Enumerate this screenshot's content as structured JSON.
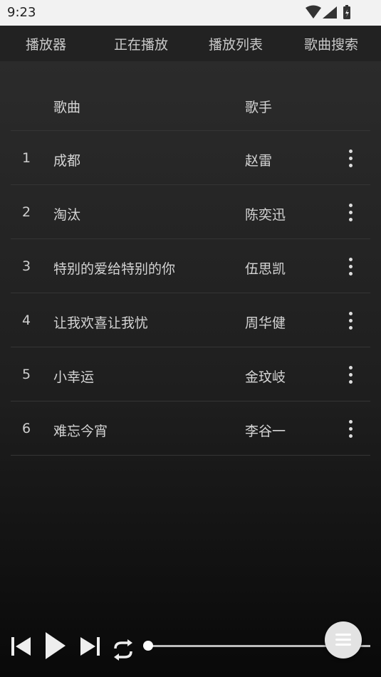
{
  "status": {
    "time": "9:23"
  },
  "tabs": [
    "播放器",
    "正在播放",
    "播放列表",
    "歌曲搜索"
  ],
  "list_header": {
    "song": "歌曲",
    "artist": "歌手"
  },
  "songs": [
    {
      "num": "1",
      "title": "成都",
      "artist": "赵雷"
    },
    {
      "num": "2",
      "title": "淘汰",
      "artist": "陈奕迅"
    },
    {
      "num": "3",
      "title": "特别的爱给特别的你",
      "artist": "伍思凯"
    },
    {
      "num": "4",
      "title": "让我欢喜让我忧",
      "artist": "周华健"
    },
    {
      "num": "5",
      "title": "小幸运",
      "artist": "金玟岐"
    },
    {
      "num": "6",
      "title": "难忘今宵",
      "artist": "李谷一"
    }
  ],
  "player": {
    "progress": 0.0
  },
  "icons": {
    "prev": "skip-previous-icon",
    "play": "play-icon",
    "next": "skip-next-icon",
    "repeat": "repeat-icon",
    "menu": "menu-icon",
    "row_more": "more-vertical-icon"
  }
}
